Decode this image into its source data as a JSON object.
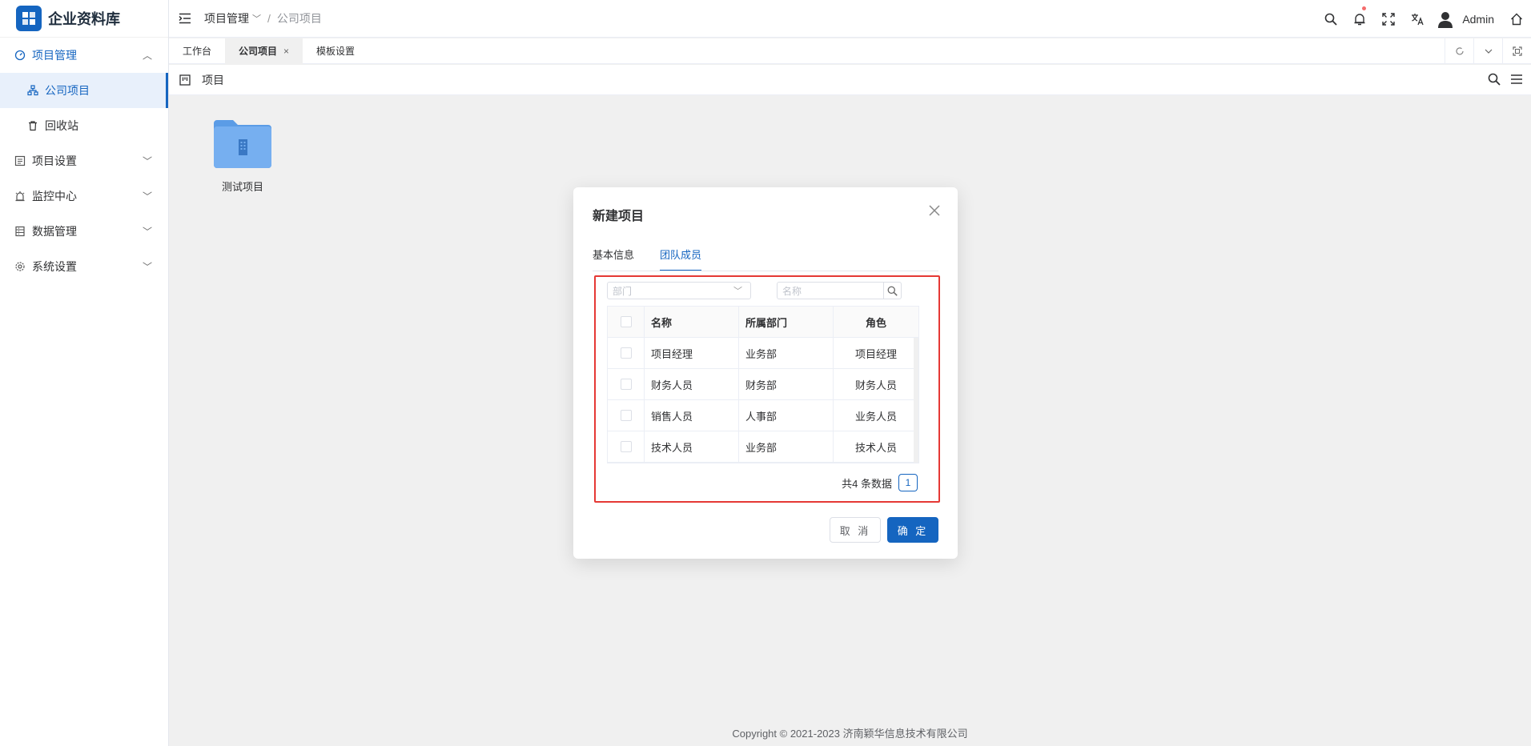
{
  "app": {
    "title": "企业资料库"
  },
  "sidebar": {
    "items": [
      {
        "label": "项目管理",
        "icon": "dashboard-icon",
        "open": true
      },
      {
        "label": "公司项目",
        "icon": "org-icon",
        "active": true
      },
      {
        "label": "回收站",
        "icon": "trash-icon"
      },
      {
        "label": "项目设置",
        "icon": "list-icon"
      },
      {
        "label": "监控中心",
        "icon": "alarm-icon"
      },
      {
        "label": "数据管理",
        "icon": "database-icon"
      },
      {
        "label": "系统设置",
        "icon": "gear-icon"
      }
    ]
  },
  "header": {
    "breadcrumb": [
      "项目管理",
      "公司项目"
    ],
    "user": "Admin"
  },
  "tabs": [
    {
      "label": "工作台"
    },
    {
      "label": "公司项目",
      "active": true,
      "close": "×"
    },
    {
      "label": "模板设置"
    }
  ],
  "page": {
    "title": "项目"
  },
  "folder": {
    "label": "测试项目"
  },
  "footer": {
    "text": "Copyright © 2021-2023 济南颖华信息技术有限公司"
  },
  "modal": {
    "title": "新建项目",
    "tabs": [
      {
        "label": "基本信息"
      },
      {
        "label": "团队成员",
        "active": true
      }
    ],
    "dept_placeholder": "部门",
    "name_placeholder": "名称",
    "table": {
      "headers": [
        "名称",
        "所属部门",
        "角色"
      ],
      "rows": [
        [
          "项目经理",
          "业务部",
          "项目经理"
        ],
        [
          "财务人员",
          "财务部",
          "财务人员"
        ],
        [
          "销售人员",
          "人事部",
          "业务人员"
        ],
        [
          "技术人员",
          "业务部",
          "技术人员"
        ]
      ]
    },
    "total": "共4 条数据",
    "page": "1",
    "cancel": "取 消",
    "ok": "确 定"
  },
  "colors": {
    "primary": "#1565c0",
    "highlight_border": "#e53935",
    "badge": "#f56c6c"
  }
}
